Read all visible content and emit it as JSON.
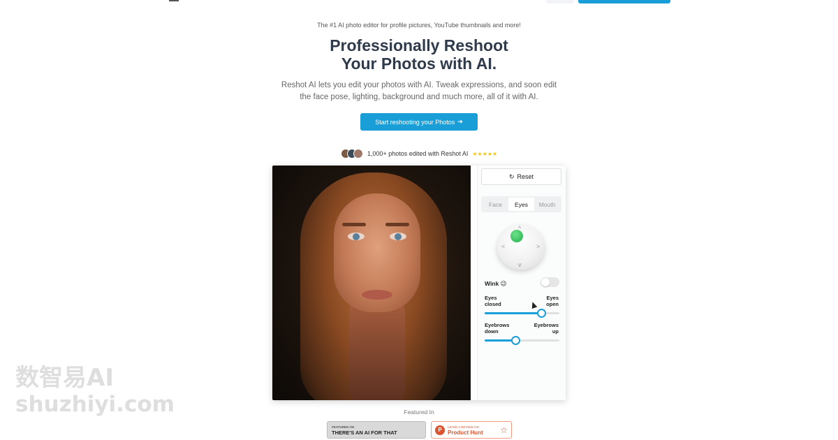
{
  "hero": {
    "tagline": "The #1 AI photo editor for profile pictures, YouTube thumbnails and more!",
    "title_line1": "Professionally Reshoot",
    "title_line2": "Your Photos with AI.",
    "subtitle_line1": "Reshot AI lets you edit your photos with AI. Tweak expressions, and soon edit",
    "subtitle_line2": "the face pose, lighting, background and much more, all of it with AI.",
    "cta_label": "Start reshooting your Photos",
    "cta_arrow": "➔"
  },
  "social_proof": {
    "text": "1,000+ photos edited with Reshot AI",
    "stars": "★★★★★",
    "avatar_colors": [
      "#7a5a44",
      "#3c4a5a",
      "#a0786a"
    ]
  },
  "editor": {
    "reset_icon": "↻",
    "reset_label": "Reset",
    "tabs": [
      {
        "label": "Face",
        "active": false
      },
      {
        "label": "Eyes",
        "active": true
      },
      {
        "label": "Mouth",
        "active": false
      }
    ],
    "joystick_chevrons": {
      "up": "^",
      "down": "v",
      "left": "<",
      "right": ">"
    },
    "wink_label": "Wink 😉",
    "wink_on": false,
    "sliders": [
      {
        "left_line1": "Eyes",
        "left_line2": "closed",
        "right_line1": "Eyes",
        "right_line2": "open",
        "value": 0.76
      },
      {
        "left_line1": "Eyebrows",
        "left_line2": "down",
        "right_line1": "Eyebrows",
        "right_line2": "up",
        "value": 0.41
      }
    ]
  },
  "featured": {
    "label": "Featured In",
    "aiforthat_text": "THERE'S AN AI FOR THAT",
    "aiforthat_small": "FEATURED ON",
    "ph_small": "LEAVE A REVIEW ON",
    "ph_name": "Product Hunt",
    "ph_letter": "P"
  },
  "watermark": {
    "cn": "数智易AI",
    "en": "shuzhiyi.com"
  },
  "colors": {
    "accent": "#1a9ed8",
    "knob": "#22b14c",
    "stars": "#f5c518",
    "producthunt": "#da552f"
  }
}
